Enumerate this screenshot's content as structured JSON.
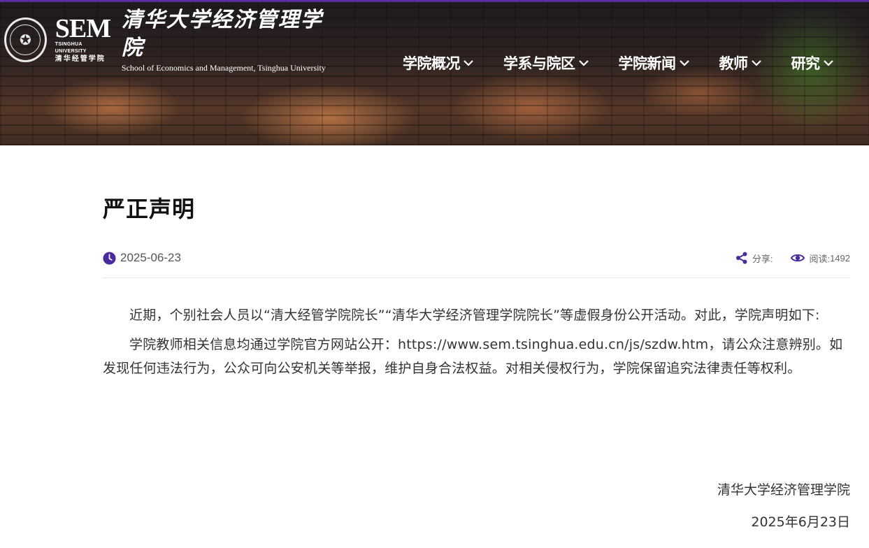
{
  "header": {
    "logo": {
      "seal_text": "清华大学",
      "sem": "SEM",
      "sem_sub_en": "TSINGHUA UNIVERSITY",
      "sem_sub_cn": "清华经管学院",
      "name_cn": "清华大学经济管理学院",
      "name_en": "School of Economics and Management, Tsinghua University"
    },
    "nav": [
      {
        "label": "学院概况"
      },
      {
        "label": "学系与院区"
      },
      {
        "label": "学院新闻"
      },
      {
        "label": "教师"
      },
      {
        "label": "研究"
      }
    ]
  },
  "article": {
    "title": "严正声明",
    "date": "2025-06-23",
    "share_label": "分享:",
    "views_label": "阅读:",
    "views": "1492",
    "paragraphs": [
      "近期，个别社会人员以“清大经管学院院长”“清华大学经济管理学院院长”等虚假身份公开活动。对此，学院声明如下:",
      "学院教师相关信息均通过学院官方网站公开：https://www.sem.tsinghua.edu.cn/js/szdw.htm，请公众注意辨别。如发现任何违法行为，公众可向公安机关等举报，维护自身合法权益。对相关侵权行为，学院保留追究法律责任等权利。"
    ],
    "signature_org": "清华大学经济管理学院",
    "signature_date": "2025年6月23日"
  },
  "colors": {
    "accent": "#4b2a9e",
    "top_bar": "#5b2aa0"
  },
  "icons": [
    "clock-icon",
    "share-icon",
    "eye-icon",
    "chevron-down-icon"
  ]
}
